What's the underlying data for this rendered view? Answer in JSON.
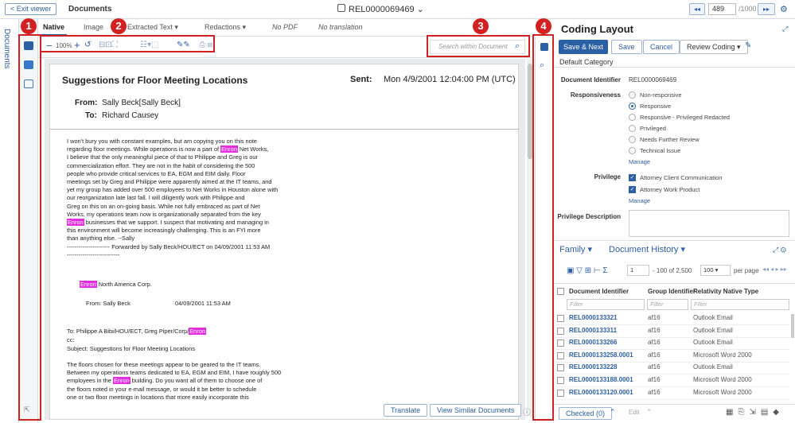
{
  "topbar": {
    "exit_label": "< Exit viewer",
    "title": "Documents",
    "doc_id": "REL0000069469 ⌄",
    "page_current": "489",
    "page_total": "/1000"
  },
  "left_rail": {
    "label": "Documents"
  },
  "viewer_tabs": [
    "Native",
    "Image",
    "Extracted Text ▾",
    "Redactions ▾",
    "No PDF",
    "No translation"
  ],
  "toolbar": {
    "zoom": "100%",
    "search_placeholder": "Search within Document"
  },
  "email": {
    "subject": "Suggestions for Floor Meeting Locations",
    "sent_label": "Sent:",
    "sent_value": "Mon 4/9/2001 12:04:00 PM (UTC)",
    "from_label": "From:",
    "from_value": "Sally Beck[Sally Beck]",
    "to_label": "To:",
    "to_value": "Richard Causey",
    "body_p1": [
      "I won't bury you with constant examples, but am copying you on this note",
      "regarding floor meetings.  While operations is now a part of [Enron] Net Works,",
      "I believe that the only meaningful piece of that to Philippe and Greg is our",
      "commercialization effort.  They are not in the habit of considering the 500",
      "people who provide critical services to EA, EGM and EIM daily.  Floor",
      "meetings set by Greg and Philippe were apparently aimed at the IT teams, and",
      "yet my group has added over 500 employees to Net Works in Houston alone with",
      "our reorganization late last fall.  I will diligently work with Philippe and",
      "Greg on this on an on-going basis.  While not fully embraced as part of Net",
      "Works, my operations team now is organizationally separated from the key",
      "[Enron] businesses that we support.  I suspect that motivating and managing in",
      "this environment will become increasingly challenging.  This is an FYI more",
      "than anything else.  --Sally",
      "---------------------- Forwarded by Sally Beck/HOU/ECT on 04/09/2001 11:53 AM",
      "---------------------------"
    ],
    "fwd_company": "North America Corp.",
    "fwd_company_hl": "Enron",
    "fwd_from": "From:  Sally Beck",
    "fwd_date": "04/09/2001 11:53 AM",
    "fwd_to_pre": "To: Philippe A Bibi/HOU/ECT, Greg Piper/Corp/",
    "fwd_to_hl": "Enron",
    "fwd_cc": "cc:",
    "fwd_subject": "Subject: Suggestions for Floor Meeting Locations",
    "body_p2": [
      "The floors chosen for these meetings appear to be geared to the IT teams.",
      "Between my operations teams dedicated to EA, EGM and EIM, I have roughly 500",
      "employees in the [Enron] building.  Do you want all of them to choose one of",
      "the floors noted in your e-mail message, or would it be better to schedule",
      "one or two floor meetings in locations that more easily incorporate this"
    ]
  },
  "footer": {
    "translate": "Translate",
    "similar": "View Similar Documents"
  },
  "callouts": [
    "1",
    "2",
    "3",
    "4"
  ],
  "coding": {
    "title": "Coding Layout",
    "save_next": "Save & Next",
    "save": "Save",
    "cancel": "Cancel",
    "review_select": "Review Coding ▾",
    "default_category": "Default Category",
    "doc_id_label": "Document Identifier",
    "doc_id_value": "REL0000069469",
    "responsiveness_label": "Responsiveness",
    "responsiveness_options": [
      "Non-responsive",
      "Responsive",
      "Responsive - Privileged Redacted",
      "Privileged",
      "Needs Further Review",
      "Technical Issue"
    ],
    "responsiveness_selected": 1,
    "manage": "Manage",
    "privilege_label": "Privilege",
    "privilege_options": [
      "Attorney Client Communication",
      "Attorney Work Product"
    ],
    "privilege_desc_label": "Privilege Description"
  },
  "family": {
    "family_label": "Family ▾",
    "history_label": "Document History ▾",
    "page_input": "1",
    "range_text": "- 100 of 2,500",
    "per_page_value": "100 ▾",
    "per_page_label": "per page",
    "columns": [
      "Document Identifier",
      "Group Identifier",
      "Relativity Native Type"
    ],
    "filter_placeholder": "Filter",
    "rows": [
      [
        "REL0000133321",
        "af16",
        "Outlook Email"
      ],
      [
        "REL0000133311",
        "af16",
        "Outlook Email"
      ],
      [
        "REL0000133266",
        "af16",
        "Outlook Email"
      ],
      [
        "REL0000133258.0001",
        "af16",
        "Microsoft Word 2000"
      ],
      [
        "REL0000133228",
        "af16",
        "Outlook Email"
      ],
      [
        "REL0000133188.0001",
        "af16",
        "Microsoft Word 2000"
      ],
      [
        "REL0000133120.0001",
        "af16",
        "Microsoft Word 2000"
      ]
    ],
    "checked": "Checked (0)",
    "edit": "Edit"
  }
}
